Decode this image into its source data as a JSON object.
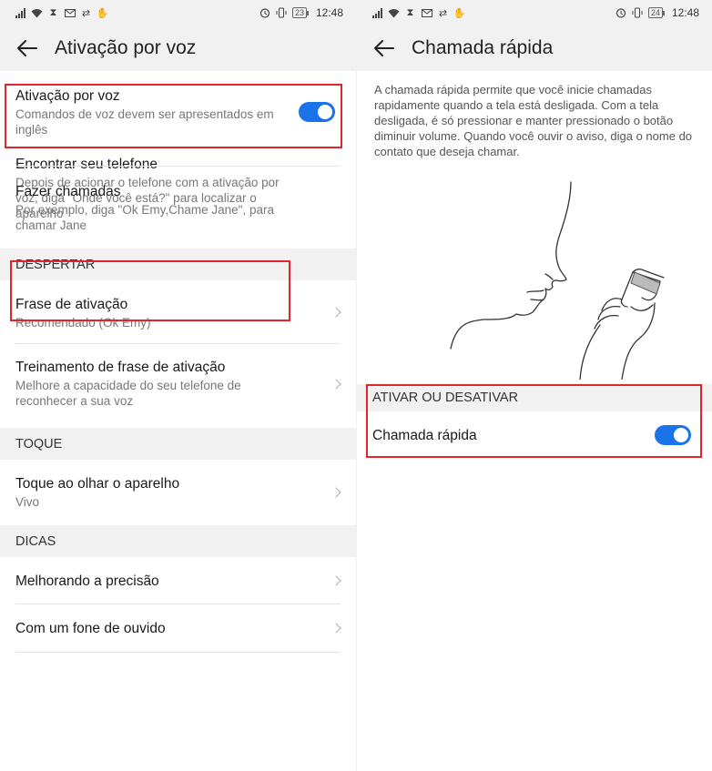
{
  "left": {
    "status": {
      "battery": "23",
      "time": "12:48"
    },
    "title": "Ativação por voz",
    "items": [
      {
        "title": "Ativação por voz",
        "subtitle": "Comandos de voz devem ser apresentados em inglês",
        "toggle": true
      },
      {
        "title": "Encontrar seu telefone",
        "subtitle": "Depois de acionar o telefone com a ativação por voz, diga \"Onde você está?\" para localizar o aparelho"
      },
      {
        "title": "Fazer chamadas",
        "subtitle": "Por exemplo, diga \"Ok Emy,Chame Jane\", para chamar Jane"
      }
    ],
    "sections": [
      {
        "header": "DESPERTAR",
        "items": [
          {
            "title": "Frase de ativação",
            "subtitle": "Recomendado (Ok Emy)"
          },
          {
            "title": "Treinamento de frase de ativação",
            "subtitle": "Melhore a capacidade do seu telefone de reconhecer a sua voz"
          }
        ]
      },
      {
        "header": "TOQUE",
        "items": [
          {
            "title": "Toque ao olhar o aparelho",
            "subtitle": "Vivo"
          }
        ]
      },
      {
        "header": "DICAS",
        "items": [
          {
            "title": "Melhorando a precisão"
          },
          {
            "title": "Com um fone de ouvido"
          }
        ]
      }
    ]
  },
  "right": {
    "status": {
      "battery": "24",
      "time": "12:48"
    },
    "title": "Chamada rápida",
    "description": "A chamada rápida permite que você inicie chamadas rapidamente quando a tela está desligada. Com a tela desligada, é só pressionar e manter pressionado o botão diminuir volume. Quando você ouvir o aviso, diga o nome do contato que deseja chamar.",
    "section_header": "ATIVAR OU DESATIVAR",
    "toggle_item": {
      "title": "Chamada rápida",
      "toggle": true
    }
  },
  "colors": {
    "accent": "#1a73e8",
    "highlight": "#e0262b",
    "header_bg": "#f1f1f1"
  },
  "icons": [
    "wifi-icon",
    "signal-icon",
    "mail-icon",
    "sync-icon",
    "hand-icon",
    "alarm-icon",
    "vibrate-icon",
    "back-arrow-icon",
    "chevron-right-icon",
    "toggle-icon"
  ]
}
